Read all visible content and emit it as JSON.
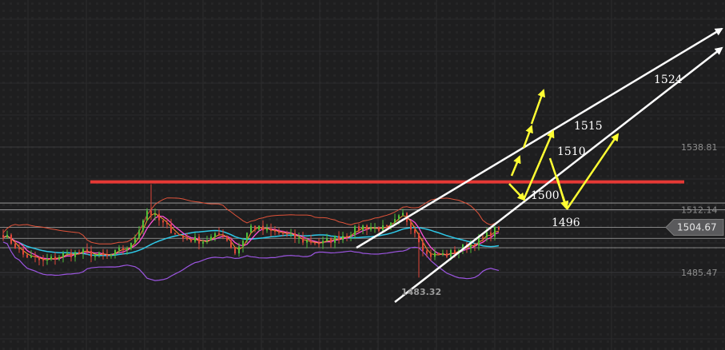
{
  "chart_data": {
    "type": "candlestick",
    "title": "",
    "y_axis": {
      "ticks": [
        "1538.81",
        "1512.14",
        "1485.47"
      ],
      "tick_values": [
        1538.81,
        1512.14,
        1485.47
      ],
      "range": [
        1477,
        1545
      ]
    },
    "current_price": {
      "label": "1504.67",
      "value": 1504.67
    },
    "period_low": {
      "label": "1483.32",
      "value": 1483.32
    },
    "resistance": {
      "label": "1524",
      "value": 1524,
      "color": "#e53935"
    },
    "levels": [
      {
        "label": "1515",
        "value": 1515
      },
      {
        "label": "1510",
        "value": 1510
      },
      {
        "label": "1500",
        "value": 1500
      },
      {
        "label": "1496",
        "value": 1496
      }
    ],
    "indicators": {
      "upper_band_color": "#e0533a",
      "lower_band_color": "#9b55e0",
      "ma_fast_color": "#ff4fd8",
      "ma_slow_color": "#2ec8e8",
      "ma_mid_color": "#ff9a2e"
    },
    "annotation_colors": {
      "trend_arrows": "#ffffff",
      "scenario_arrows": "#ffff33"
    }
  }
}
